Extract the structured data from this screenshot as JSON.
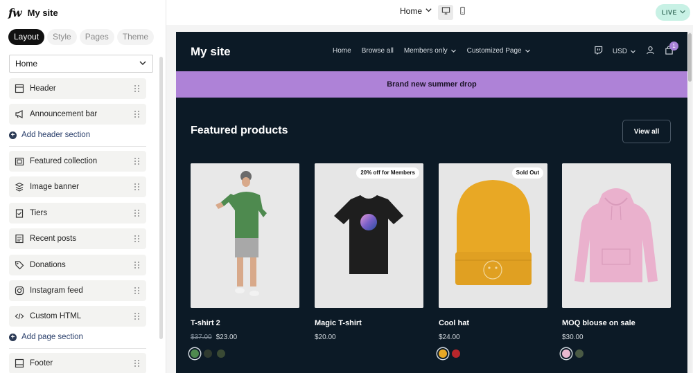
{
  "brand": {
    "logo": "fw",
    "site_name": "My site"
  },
  "editor_tabs": [
    "Layout",
    "Style",
    "Pages",
    "Theme"
  ],
  "page_select": {
    "value": "Home"
  },
  "sections": {
    "header_group": [
      "Header",
      "Announcement bar"
    ],
    "add_header_label": "Add header section",
    "page_group": [
      "Featured collection",
      "Image banner",
      "Tiers",
      "Recent posts",
      "Donations",
      "Instagram feed",
      "Custom HTML"
    ],
    "add_page_label": "Add page section",
    "footer_group": [
      "Footer"
    ]
  },
  "topbar": {
    "page": "Home",
    "status": "LIVE"
  },
  "store": {
    "title": "My site",
    "nav": [
      "Home",
      "Browse all",
      "Members only",
      "Customized Page"
    ],
    "currency": "USD",
    "cart_count": "1",
    "announcement": "Brand new summer drop",
    "featured_title": "Featured products",
    "view_all": "View all",
    "products": [
      {
        "name": "T-shirt 2",
        "old_price": "$37.00",
        "price": "$23.00",
        "badge": "",
        "swatches": [
          "#4f8a4f",
          "#2f3a2f",
          "#3a4a34"
        ]
      },
      {
        "name": "Magic T-shirt",
        "old_price": "",
        "price": "$20.00",
        "badge": "20% off for Members",
        "swatches": []
      },
      {
        "name": "Cool hat",
        "old_price": "",
        "price": "$24.00",
        "badge": "Sold Out",
        "swatches": [
          "#e8a825",
          "#b8262b"
        ]
      },
      {
        "name": "MOQ blouse on sale",
        "old_price": "",
        "price": "$30.00",
        "badge": "",
        "swatches": [
          "#e9b8cf",
          "#4a5a44"
        ]
      }
    ]
  },
  "colors": {
    "store_bg": "#0c1a26",
    "announcement_bg": "#ae82d7",
    "live_bg": "#c8f1e5"
  }
}
